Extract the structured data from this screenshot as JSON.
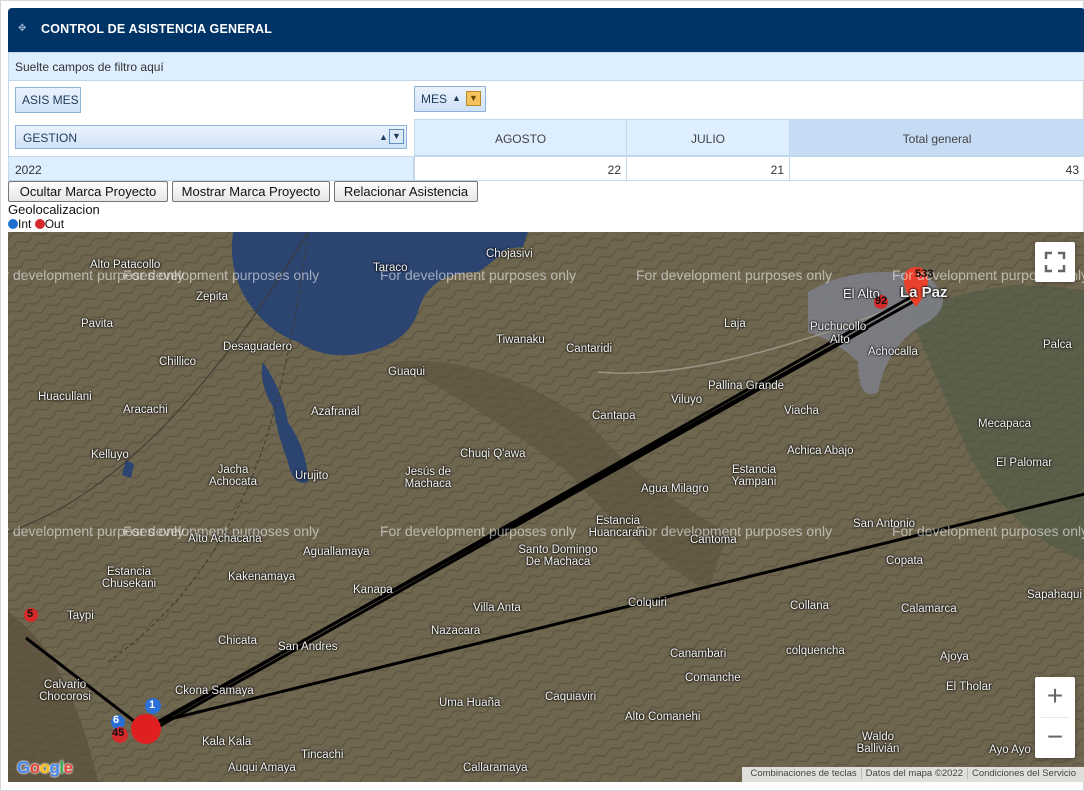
{
  "panel": {
    "title": "CONTROL DE ASISTENCIA GENERAL",
    "grip_icon": "move-handle-icon"
  },
  "pivot": {
    "filter_placeholder": "Suelte campos de filtro aquí",
    "data_field": "ASIS MES",
    "column_field": "MES",
    "row_field": "GESTION",
    "columns": [
      "AGOSTO",
      "JULIO",
      "Total general"
    ],
    "rows": [
      {
        "label": "2022",
        "values": [
          "22",
          "21",
          "43"
        ]
      }
    ]
  },
  "actions": {
    "hide_button": "Ocultar Marca Proyecto",
    "show_button": "Mostrar Marca Proyecto",
    "relate_button": "Relacionar Asistencia"
  },
  "geo": {
    "title": "Geolocalizacion",
    "legend": [
      {
        "label": "Int",
        "color": "#1f6fd1"
      },
      {
        "label": "Out",
        "color": "#d42a2a"
      }
    ]
  },
  "map": {
    "watermark": "For development purposes only",
    "labels": [
      "Alto Patacollo",
      "Taraco",
      "Chojasivi",
      "Zepita",
      "Pavita",
      "Desaguadero",
      "Chillico",
      "Guaqui",
      "Tiwanaku",
      "Cantaridi",
      "Laja",
      "Puchucollo",
      "Alto",
      "El Alto",
      "La Paz",
      "Achocalla",
      "Palca",
      "Huacullani",
      "Aracachi",
      "Azafranal",
      "Pallina Grande",
      "Viluyo",
      "Cantapa",
      "Viacha",
      "Mecapaca",
      "Kelluyo",
      "Chuqi Q'awa",
      "Achica Abajo",
      "Jacha Achocata",
      "Urujito",
      "Jesús de Machaca",
      "Estancia Yampani",
      "Agua Milagro",
      "El Palomar",
      "Alto Achacana",
      "Aguallamaya",
      "Santo Domingo De Machaca",
      "Estancia Huancarani",
      "Cantoma",
      "San Antonio",
      "Estancia Chusekani",
      "Kakenamaya",
      "Copata",
      "Taypi",
      "Kanapa",
      "Sapahaqui",
      "Villa Anta",
      "Colquiri",
      "Collana",
      "Calamarca",
      "Chicata",
      "San Andres",
      "Nazacara",
      "Canambari",
      "colquencha",
      "Ajoya",
      "Calvario Chocorosi",
      "Ckona Samaya",
      "Comanche",
      "El Tholar",
      "Uma Huaña",
      "Caquiaviri",
      "Alto Comanehi",
      "Kala Kala",
      "Waldo Ballivián",
      "Tincachi",
      "Auqui Amaya",
      "Callaramaya",
      "Ayo Ayo"
    ],
    "cluster_labels": [
      "533",
      "92",
      "5",
      "45",
      "6",
      "1"
    ],
    "fullscreen_icon": "fullscreen-icon",
    "zoom_in": "+",
    "zoom_out": "−",
    "google_logo": "Google",
    "attribution": [
      "Combinaciones de teclas",
      "Datos del mapa ©2022",
      "Condiciones del Servicio"
    ]
  }
}
